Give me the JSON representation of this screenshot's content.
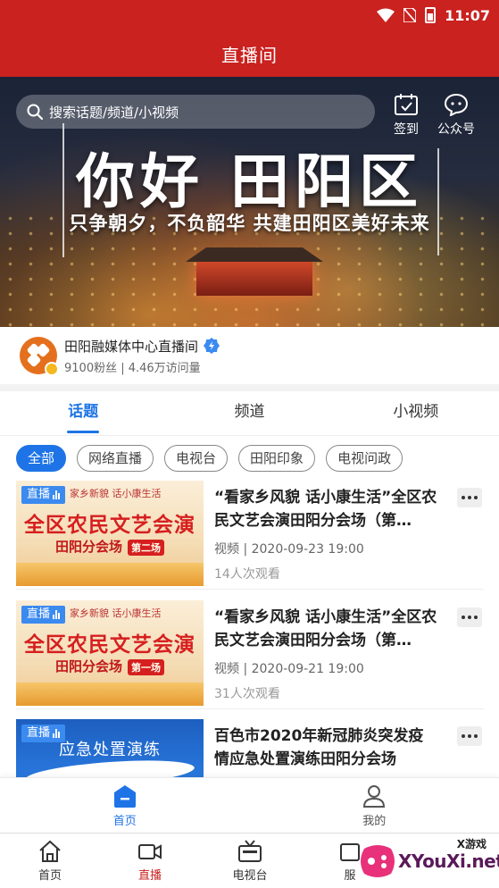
{
  "status_bar": {
    "time": "11:07"
  },
  "header": {
    "title": "直播间"
  },
  "search": {
    "placeholder": "搜索话题/频道/小视频"
  },
  "top_actions": [
    {
      "label": "签到",
      "icon": "calendar-check-icon"
    },
    {
      "label": "公众号",
      "icon": "chat-bubble-icon"
    }
  ],
  "banner": {
    "headline": "你好 田阳区",
    "subline": "只争朝夕，不负韶华  共建田阳区美好未来"
  },
  "channel": {
    "name": "田阳融媒体中心直播间",
    "stats": "9100粉丝 | 4.46万访问量"
  },
  "tabs": [
    {
      "label": "话题",
      "active": true
    },
    {
      "label": "频道",
      "active": false
    },
    {
      "label": "小视频",
      "active": false
    }
  ],
  "filters": [
    {
      "label": "全部",
      "active": true
    },
    {
      "label": "网络直播",
      "active": false
    },
    {
      "label": "电视台",
      "active": false
    },
    {
      "label": "田阳印象",
      "active": false
    },
    {
      "label": "电视问政",
      "active": false
    }
  ],
  "items": [
    {
      "tag": "直播",
      "thumb_top": "家乡新貌  话小康生活",
      "thumb_main": "全区农民文艺会演",
      "thumb_sub": "田阳分会场",
      "thumb_badge": "第二场",
      "title": "“看家乡风貌 话小康生活”全区农民文艺会演田阳分会场（第…",
      "meta": "视频 | 2020-09-23 19:00",
      "views": "14人次观看"
    },
    {
      "tag": "直播",
      "thumb_top": "家乡新貌  话小康生活",
      "thumb_main": "全区农民文艺会演",
      "thumb_sub": "田阳分会场",
      "thumb_badge": "第一场",
      "title": "“看家乡风貌 话小康生活”全区农民文艺会演田阳分会场（第…",
      "meta": "视频 | 2020-09-21 19:00",
      "views": "31人次观看"
    },
    {
      "tag": "直播",
      "thumb_main": "应急处置演练",
      "title": "百色市2020年新冠肺炎突发疫情应急处置演练田阳分会场"
    }
  ],
  "inner_nav": [
    {
      "label": "首页",
      "icon": "home-doc-icon",
      "active": true
    },
    {
      "label": "我的",
      "icon": "person-icon",
      "active": false
    }
  ],
  "bottom_nav": [
    {
      "label": "首页",
      "icon": "house-icon",
      "active": false
    },
    {
      "label": "直播",
      "icon": "video-camera-icon",
      "active": true
    },
    {
      "label": "电视台",
      "icon": "tv-icon",
      "active": false
    },
    {
      "label": "服",
      "icon": "service-icon",
      "active": false
    }
  ],
  "watermark": {
    "text": "XYouXi.net",
    "small": "X游戏"
  },
  "colors": {
    "brand_red": "#c9221f",
    "accent_blue": "#1e74e6"
  }
}
